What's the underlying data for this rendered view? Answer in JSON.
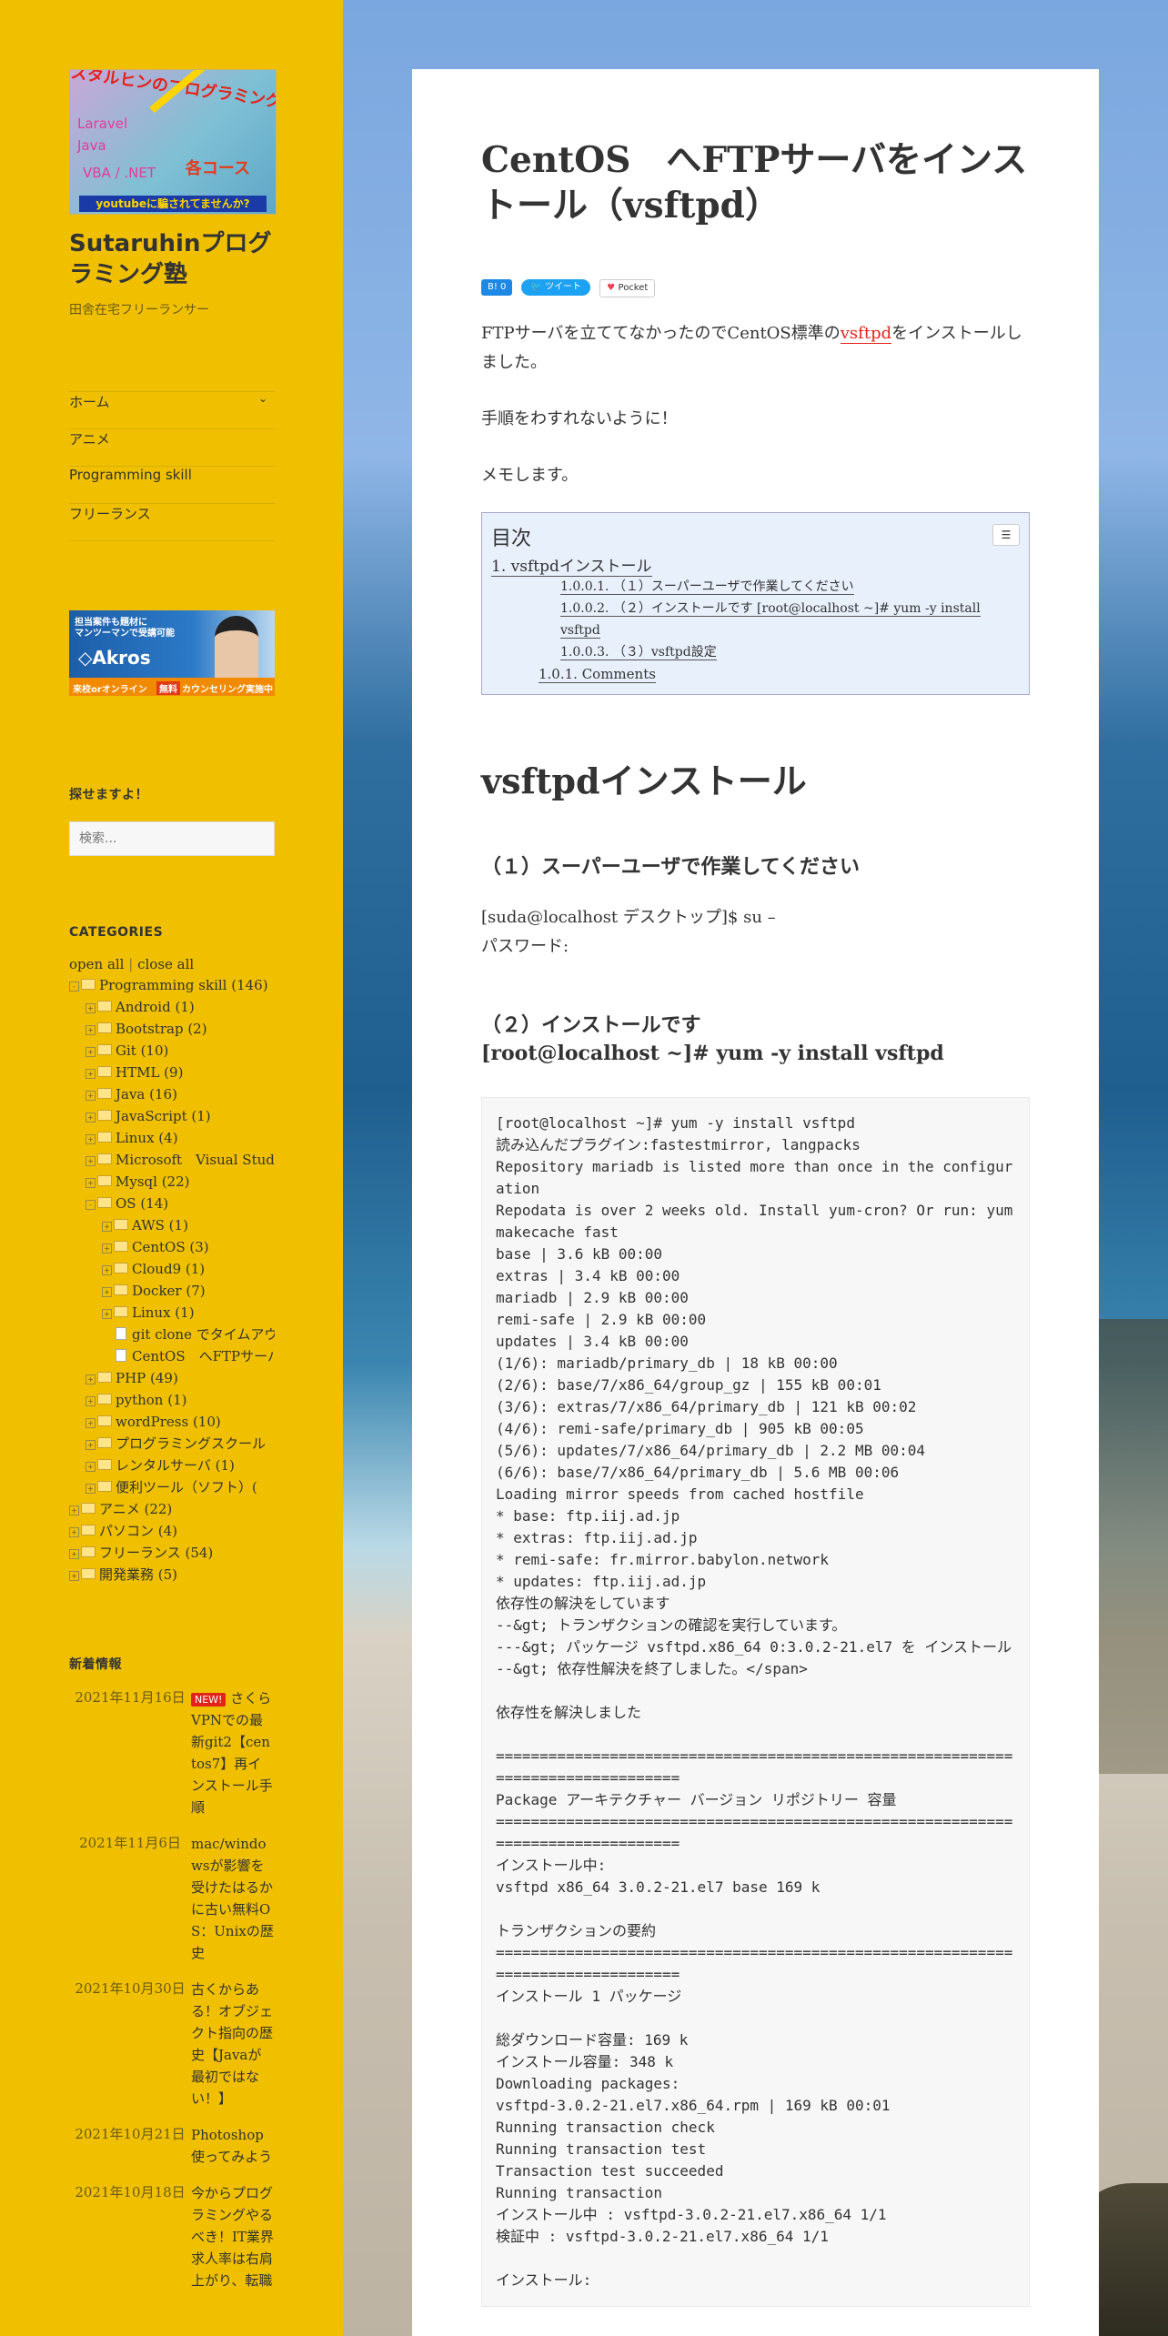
{
  "site": {
    "logo": {
      "headline": "スタルヒンのプログラミング塾",
      "words": [
        "Laravel",
        "Java",
        "VBA / .NET"
      ],
      "course": "各コース",
      "tagline": "youtubeに騙されてませんか?"
    },
    "title": "Sutaruhinプログラミング塾",
    "description": "田舎在宅フリーランサー"
  },
  "nav": {
    "items": [
      {
        "label": "ホーム",
        "chevron": "⌄"
      },
      {
        "label": "アニメ"
      },
      {
        "label": "Programming skill"
      },
      {
        "label": "フリーランス"
      }
    ]
  },
  "banner": {
    "line1": "担当案件も題材に",
    "line2": "マンツーマンで受講可能",
    "brand": "◇Akros",
    "bottom_left": "来校orオンライン",
    "free": "無料",
    "bottom_right": "カウンセリング実施中"
  },
  "search_widget": {
    "title": "探せますよ！",
    "placeholder": "検索..."
  },
  "categories": {
    "title": "CATEGORIES",
    "open_all": "open all",
    "sep": "|",
    "close_all": "close all",
    "tree": [
      {
        "label": "Programming skill (146)",
        "level": 0,
        "toggle": "-"
      },
      {
        "label": "Android (1)",
        "level": 1,
        "toggle": "+"
      },
      {
        "label": "Bootstrap (2)",
        "level": 1,
        "toggle": "+"
      },
      {
        "label": "Git (10)",
        "level": 1,
        "toggle": "+"
      },
      {
        "label": "HTML (9)",
        "level": 1,
        "toggle": "+"
      },
      {
        "label": "Java (16)",
        "level": 1,
        "toggle": "+"
      },
      {
        "label": "JavaScript (1)",
        "level": 1,
        "toggle": "+"
      },
      {
        "label": "Linux (4)",
        "level": 1,
        "toggle": "+"
      },
      {
        "label": "Microsoft　Visual Studio",
        "level": 1,
        "toggle": "+"
      },
      {
        "label": "Mysql (22)",
        "level": 1,
        "toggle": "+"
      },
      {
        "label": "OS (14)",
        "level": 1,
        "toggle": "-"
      },
      {
        "label": "AWS (1)",
        "level": 2,
        "toggle": "+"
      },
      {
        "label": "CentOS (3)",
        "level": 2,
        "toggle": "+"
      },
      {
        "label": "Cloud9 (1)",
        "level": 2,
        "toggle": "+"
      },
      {
        "label": "Docker (7)",
        "level": 2,
        "toggle": "+"
      },
      {
        "label": "Linux (1)",
        "level": 2,
        "toggle": "+"
      },
      {
        "label": "git clone でタイムアウト",
        "level": 2,
        "toggle": "",
        "file": true
      },
      {
        "label": "CentOS　へFTPサーバを",
        "level": 2,
        "toggle": "",
        "file": true
      },
      {
        "label": "PHP (49)",
        "level": 1,
        "toggle": "+"
      },
      {
        "label": "python (1)",
        "level": 1,
        "toggle": "+"
      },
      {
        "label": "wordPress (10)",
        "level": 1,
        "toggle": "+"
      },
      {
        "label": "プログラミングスクール",
        "level": 1,
        "toggle": "+"
      },
      {
        "label": "レンタルサーバ (1)",
        "level": 1,
        "toggle": "+"
      },
      {
        "label": "便利ツール（ソフト）(",
        "level": 1,
        "toggle": "+"
      },
      {
        "label": "アニメ (22)",
        "level": 0,
        "toggle": "+"
      },
      {
        "label": "パソコン (4)",
        "level": 0,
        "toggle": "+"
      },
      {
        "label": "フリーランス (54)",
        "level": 0,
        "toggle": "+"
      },
      {
        "label": "開発業務 (5)",
        "level": 0,
        "toggle": "+"
      }
    ]
  },
  "recent": {
    "title": "新着情報",
    "new_badge": "NEW!",
    "posts": [
      {
        "date": "2021年11月16日",
        "title": "さくらVPNでの最新git2【centos7】再インストール手順"
      },
      {
        "date": "2021年11月6日",
        "title": "mac/windowsが影響を受けたはるかに古い無料OS：Unixの歴史"
      },
      {
        "date": "2021年10月30日",
        "title": "古くからある！オブジェクト指向の歴史【Javaが最初ではない！】"
      },
      {
        "date": "2021年10月21日",
        "title": "Photoshop使ってみよう"
      },
      {
        "date": "2021年10月18日",
        "title": "今からプログラミングやるべき！IT業界求人率は右肩上がり、転職"
      }
    ]
  },
  "article": {
    "title": "CentOS　へFTPサーバをインストール（vsftpd）",
    "share": {
      "hatena": "B! 0",
      "tweet": "ツイート",
      "pocket": "Pocket"
    },
    "intro_before": "FTPサーバを立ててなかったのでCentOS標準の",
    "intro_link": "vsftpd",
    "intro_after": "をインストールしました。",
    "p2": "手順をわすれないように！",
    "p3": "メモします。",
    "toc": {
      "title": "目次",
      "toggle": "☰",
      "items": [
        {
          "label": "1. vsftpdインストール",
          "level": 1
        },
        {
          "label": "1.0.0.1. （１）スーパーユーザで作業してください",
          "level": 3
        },
        {
          "label": "1.0.0.2. （２）インストールです [root@localhost ~]# yum -y install vsftpd",
          "level": 3
        },
        {
          "label": "1.0.0.3. （３）vsftpd設定",
          "level": 3
        },
        {
          "label": "1.0.1. Comments",
          "level": 2
        }
      ]
    },
    "h2": "vsftpdインストール",
    "step1": "（１）スーパーユーザで作業してください",
    "step1_cmd": "[suda@localhost デスクトップ]$ su –",
    "step1_pw": "パスワード:",
    "step2_line1": "（２）インストールです",
    "step2_line2": "[root@localhost ~]# yum -y install vsftpd",
    "code": "[root@localhost ~]# yum -y install vsftpd\n読み込んだプラグイン:fastestmirror, langpacks\nRepository mariadb is listed more than once in the configuration\nRepodata is over 2 weeks old. Install yum-cron? Or run: yum makecache fast\nbase | 3.6 kB 00:00\nextras | 3.4 kB 00:00\nmariadb | 2.9 kB 00:00\nremi-safe | 2.9 kB 00:00\nupdates | 3.4 kB 00:00\n(1/6): mariadb/primary_db | 18 kB 00:00\n(2/6): base/7/x86_64/group_gz | 155 kB 00:01\n(3/6): extras/7/x86_64/primary_db | 121 kB 00:02\n(4/6): remi-safe/primary_db | 905 kB 00:05\n(5/6): updates/7/x86_64/primary_db | 2.2 MB 00:04\n(6/6): base/7/x86_64/primary_db | 5.6 MB 00:06\nLoading mirror speeds from cached hostfile\n* base: ftp.iij.ad.jp\n* extras: ftp.iij.ad.jp\n* remi-safe: fr.mirror.babylon.network\n* updates: ftp.iij.ad.jp\n依存性の解決をしています\n--&gt; トランザクションの確認を実行しています。\n---&gt; パッケージ vsftpd.x86_64 0:3.0.2-21.el7 を インストール\n--&gt; 依存性解決を終了しました。</span>\n\n依存性を解決しました\n\n================================================================================\nPackage アーキテクチャー バージョン リポジトリー 容量\n================================================================================\nインストール中:\nvsftpd x86_64 3.0.2-21.el7 base 169 k\n\nトランザクションの要約\n================================================================================\nインストール 1 パッケージ\n\n総ダウンロード容量: 169 k\nインストール容量: 348 k\nDownloading packages:\nvsftpd-3.0.2-21.el7.x86_64.rpm | 169 kB 00:01\nRunning transaction check\nRunning transaction test\nTransaction test succeeded\nRunning transaction\nインストール中 : vsftpd-3.0.2-21.el7.x86_64 1/1\n検証中 : vsftpd-3.0.2-21.el7.x86_64 1/1\n\nインストール:"
  }
}
